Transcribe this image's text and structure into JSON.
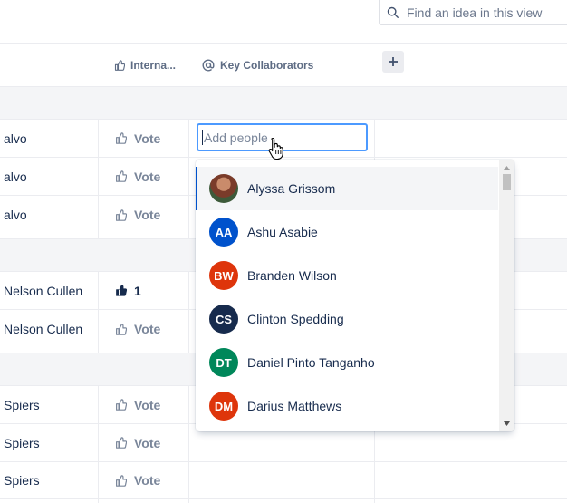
{
  "search": {
    "placeholder": "Find an idea in this view"
  },
  "header": {
    "votes_label": "Interna...",
    "collaborators_label": "Key Collaborators"
  },
  "rows": [
    {
      "name": "alvo",
      "vote": "Vote"
    },
    {
      "name": "alvo",
      "vote": "Vote"
    },
    {
      "name": "alvo",
      "vote": "Vote"
    },
    {
      "name": "Nelson Cullen",
      "vote": "1"
    },
    {
      "name": "Nelson Cullen",
      "vote": "Vote"
    },
    {
      "name": "Spiers",
      "vote": "Vote"
    },
    {
      "name": "Spiers",
      "vote": "Vote"
    },
    {
      "name": "Spiers",
      "vote": "Vote"
    }
  ],
  "add_people": {
    "placeholder": "Add people"
  },
  "people": [
    {
      "name": "Alyssa Grissom",
      "initials": "",
      "color": ""
    },
    {
      "name": "Ashu Asabie",
      "initials": "AA",
      "color": "#0052cc"
    },
    {
      "name": "Branden Wilson",
      "initials": "BW",
      "color": "#de350b"
    },
    {
      "name": "Clinton Spedding",
      "initials": "CS",
      "color": "#172b4d"
    },
    {
      "name": "Daniel Pinto Tanganho",
      "initials": "DT",
      "color": "#00875a"
    },
    {
      "name": "Darius Matthews",
      "initials": "DM",
      "color": "#de350b"
    }
  ],
  "colors": {
    "accent": "#0052cc",
    "focus": "#4c9aff",
    "border": "#ebecf0",
    "group_bg": "#f4f5f7"
  }
}
